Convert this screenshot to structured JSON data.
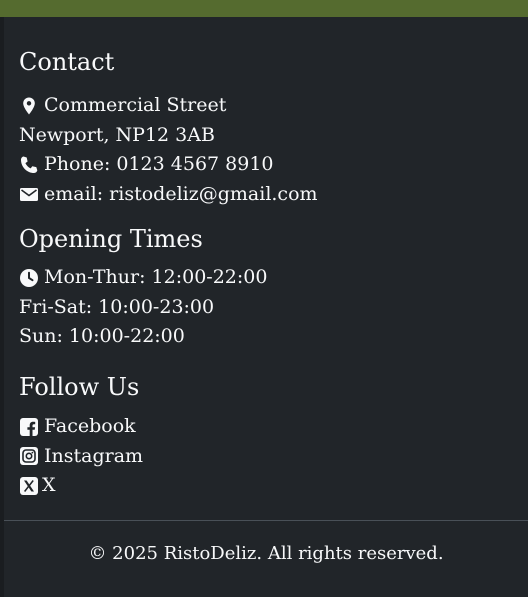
{
  "colors": {
    "background": "#212529",
    "top_band": "#556b2f",
    "text": "#f8f9fa",
    "divider": "#495057"
  },
  "contact": {
    "heading": "Contact",
    "address_line1": "Commercial Street",
    "address_line2": "Newport, NP12 3AB",
    "phone": "Phone: 0123 4567 8910",
    "email": "email: ristodeliz@gmail.com",
    "icons": [
      "map-marker-icon",
      "phone-icon",
      "envelope-icon"
    ]
  },
  "opening_times": {
    "heading": "Opening Times",
    "mon_thur": "Mon-Thur: 12:00-22:00",
    "fri_sat": "Fri-Sat: 10:00-23:00",
    "sun": "Sun: 10:00-22:00",
    "icon": "clock-icon"
  },
  "follow": {
    "heading": "Follow Us",
    "facebook": "Facebook",
    "instagram": "Instagram",
    "x": "X",
    "icons": [
      "facebook-icon",
      "instagram-icon",
      "x-icon"
    ]
  },
  "footer": {
    "copyright": "© 2025 RistoDeliz. All rights reserved."
  }
}
